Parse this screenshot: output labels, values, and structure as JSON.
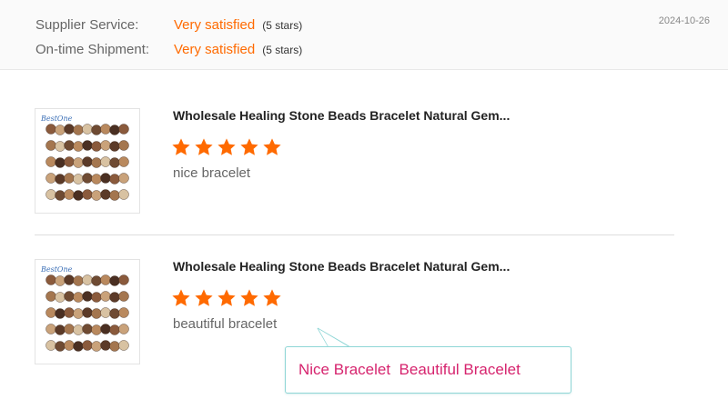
{
  "ratings": {
    "supplier_service": {
      "label": "Supplier Service:",
      "value": "Very satisfied",
      "stars_text": "(5 stars)"
    },
    "on_time_shipment": {
      "label": "On-time Shipment:",
      "value": "Very satisfied",
      "stars_text": "(5 stars)"
    },
    "date": "2024-10-26"
  },
  "reviews": [
    {
      "product_title": "Wholesale Healing Stone Beads Bracelet Natural Gem...",
      "rating": 5,
      "text": "nice bracelet",
      "thumbnail_logo": "BestOne"
    },
    {
      "product_title": "Wholesale Healing Stone Beads Bracelet Natural Gem...",
      "rating": 5,
      "text": "beautiful bracelet",
      "thumbnail_logo": "BestOne"
    }
  ],
  "tooltip": {
    "text": "Nice Bracelet  Beautiful Bracelet"
  },
  "colors": {
    "accent": "#ff6a00",
    "star": "#ff6a00",
    "tooltip_text": "#d6246e",
    "tooltip_border": "#8fd6d6"
  },
  "icons": {
    "star": "star-icon",
    "thumbnail": "bracelet-thumbnail-icon"
  }
}
